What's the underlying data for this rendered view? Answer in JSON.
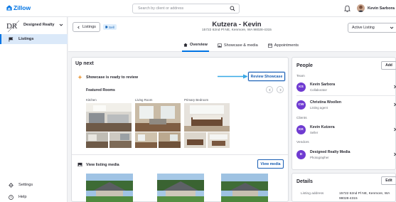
{
  "app": {
    "name": "Zillow",
    "accent": "#0074e4"
  },
  "topbar": {
    "search_placeholder": "Search by client or address",
    "user_name": "Kevin Sarbora"
  },
  "sidebar": {
    "brand_initials": "DR",
    "brand_name": "Designed Realty",
    "items": [
      {
        "label": "Listings",
        "icon": "flag-icon",
        "active": true
      },
      {
        "label": "Settings",
        "icon": "gear-icon",
        "active": false
      },
      {
        "label": "Help",
        "icon": "help-icon",
        "active": false
      }
    ]
  },
  "listing": {
    "back_label": "Listings",
    "badge": "Sell",
    "title": "Kutzera - Kevin",
    "address": "15722 62nd Pl NE, Kenmore, WA 98028-4315",
    "status": "Active Listing",
    "tabs": [
      {
        "label": "Overview",
        "icon": "home-icon",
        "active": true
      },
      {
        "label": "Showcase & media",
        "icon": "image-icon",
        "active": false
      },
      {
        "label": "Appointments",
        "icon": "calendar-icon",
        "active": false
      }
    ]
  },
  "upnext": {
    "title": "Up next",
    "showcase_title": "Showcase is ready to review",
    "review_button": "Review Showcase",
    "featured_title": "Featured Rooms",
    "rooms": [
      "Kitchen",
      "Living Room",
      "Primary Bedroom"
    ],
    "view_media_title": "View listing media",
    "view_media_button": "View media"
  },
  "people": {
    "title": "People",
    "add_button": "Add",
    "groups": [
      {
        "label": "Team",
        "people": [
          {
            "initials": "KS",
            "name": "Kevin Sarbora",
            "role": "Collaborator"
          },
          {
            "initials": "CW",
            "name": "Christina Woollen",
            "role": "Listing agent"
          }
        ]
      },
      {
        "label": "Clients",
        "people": [
          {
            "initials": "KK",
            "name": "Kevin Kutzera",
            "role": "Seller"
          }
        ]
      },
      {
        "label": "Vendors",
        "people": [
          {
            "initials": "D",
            "name": "Designed Realty Media",
            "role": "Photographer"
          }
        ]
      }
    ]
  },
  "details": {
    "title": "Details",
    "edit_button": "Edit",
    "label": "Listing address",
    "value": "15722 62nd Pl NE, Kenmore, WA 98028-4315"
  }
}
